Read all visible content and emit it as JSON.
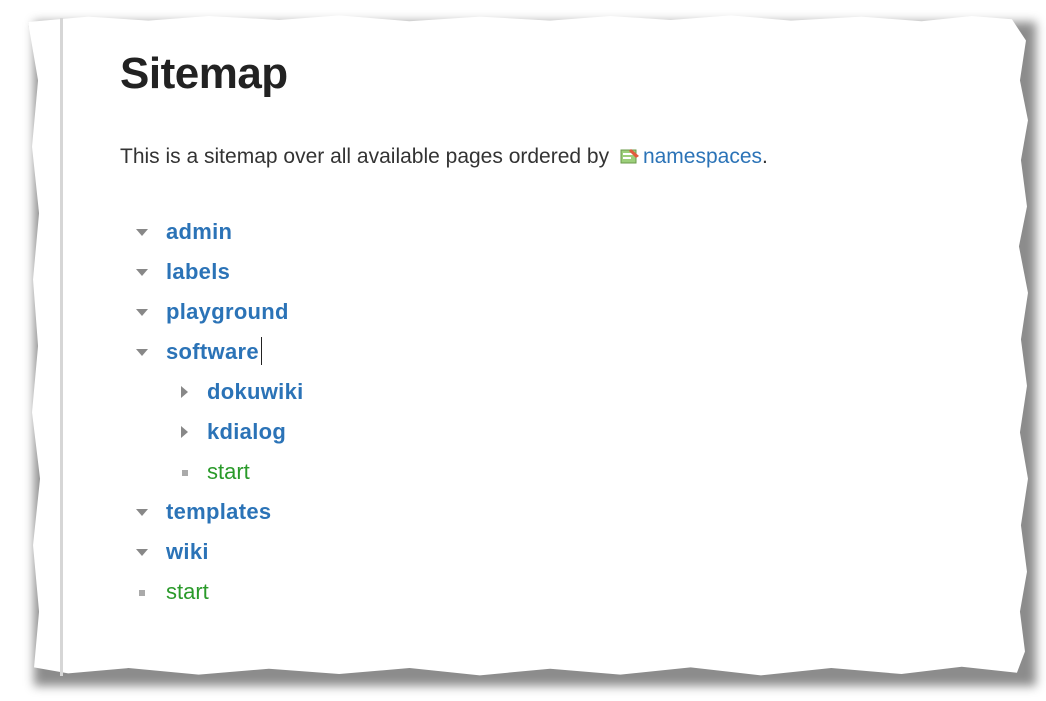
{
  "page": {
    "title": "Sitemap",
    "intro_text": "This is a sitemap over all available pages ordered by",
    "intro_link": "namespaces",
    "intro_end": "."
  },
  "tree": {
    "admin": "admin",
    "labels": "labels",
    "playground": "playground",
    "software": "software",
    "dokuwiki": "dokuwiki",
    "kdialog": "kdialog",
    "software_start": "start",
    "templates": "templates",
    "wiki": "wiki",
    "root_start": "start"
  },
  "colors": {
    "namespace_link": "#2b73b7",
    "page_link": "#2a9a2a",
    "title": "#222222"
  },
  "icons": {
    "namespaces_link_icon": "namespace-icon",
    "expanded": "triangle-down-icon",
    "collapsed": "triangle-right-icon",
    "page": "square-bullet-icon"
  }
}
